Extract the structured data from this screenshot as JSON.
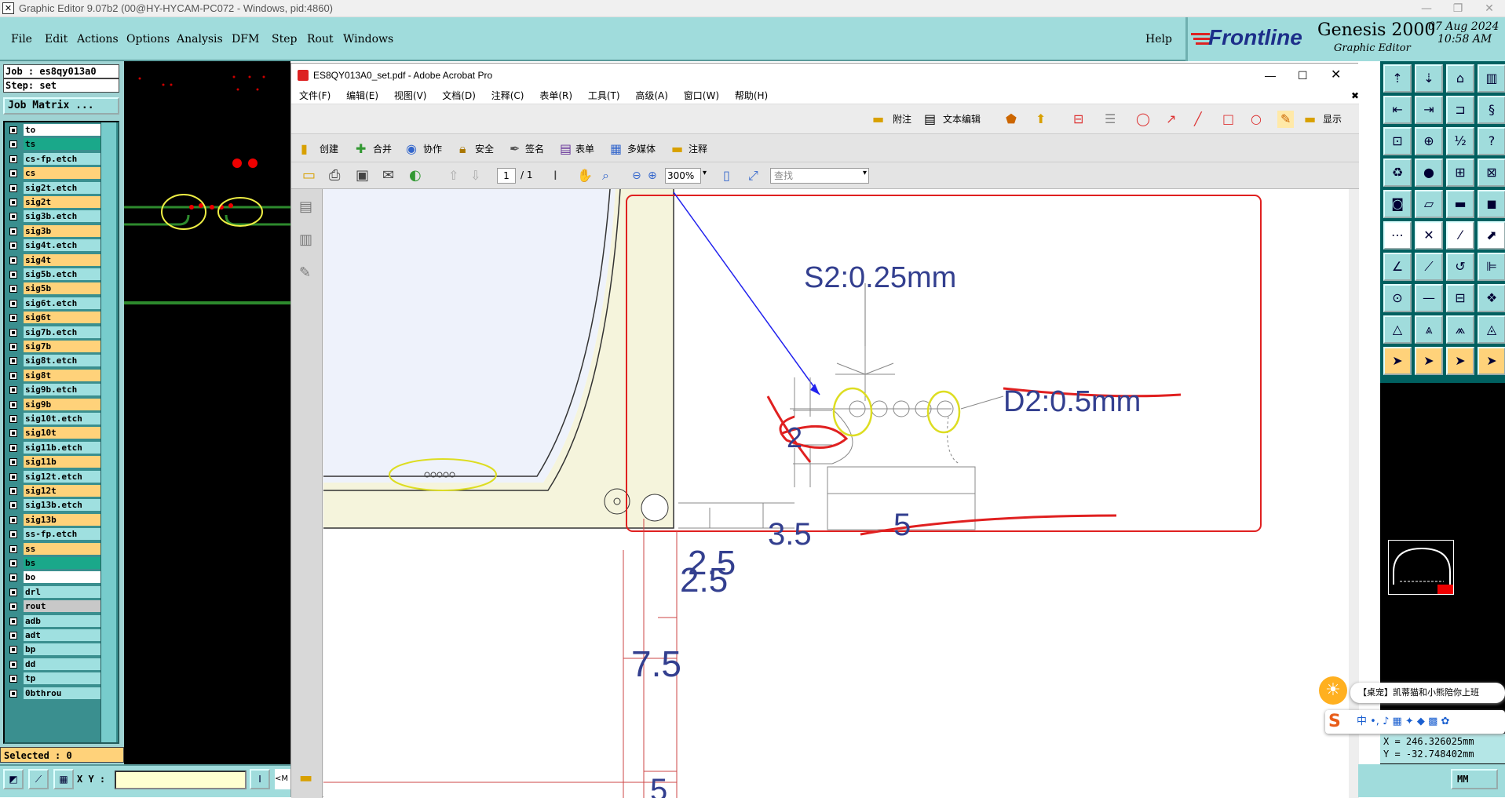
{
  "app": {
    "title": "Graphic Editor 9.07b2 (00@HY-HYCAM-PC072 - Windows, pid:4860)",
    "menu": [
      "File",
      "Edit",
      "Actions",
      "Options",
      "Analysis",
      "DFM",
      "Step",
      "Rout",
      "Windows"
    ],
    "help": "Help",
    "brand": "Frontline",
    "product": "Genesis 2000",
    "subtitle": "Graphic Editor",
    "date": "07 Aug 2024",
    "time": "10:58 AM"
  },
  "job": {
    "job_label": "Job : es8qy013a0",
    "step_label": "Step: set",
    "matrix_button": "Job Matrix ...",
    "selected": "Selected : 0",
    "xy_label": "X Y :",
    "layers": [
      {
        "name": "to",
        "color": "#ffffff"
      },
      {
        "name": "ts",
        "color": "#1aa88a"
      },
      {
        "name": "cs-fp.etch",
        "color": "#9fe0e0"
      },
      {
        "name": "cs",
        "color": "#ffd27a"
      },
      {
        "name": "sig2t.etch",
        "color": "#9fe0e0"
      },
      {
        "name": "sig2t",
        "color": "#ffd27a"
      },
      {
        "name": "sig3b.etch",
        "color": "#9fe0e0"
      },
      {
        "name": "sig3b",
        "color": "#ffd27a"
      },
      {
        "name": "sig4t.etch",
        "color": "#9fe0e0"
      },
      {
        "name": "sig4t",
        "color": "#ffd27a"
      },
      {
        "name": "sig5b.etch",
        "color": "#9fe0e0"
      },
      {
        "name": "sig5b",
        "color": "#ffd27a"
      },
      {
        "name": "sig6t.etch",
        "color": "#9fe0e0"
      },
      {
        "name": "sig6t",
        "color": "#ffd27a"
      },
      {
        "name": "sig7b.etch",
        "color": "#9fe0e0"
      },
      {
        "name": "sig7b",
        "color": "#ffd27a"
      },
      {
        "name": "sig8t.etch",
        "color": "#9fe0e0"
      },
      {
        "name": "sig8t",
        "color": "#ffd27a"
      },
      {
        "name": "sig9b.etch",
        "color": "#9fe0e0"
      },
      {
        "name": "sig9b",
        "color": "#ffd27a"
      },
      {
        "name": "sig10t.etch",
        "color": "#9fe0e0"
      },
      {
        "name": "sig10t",
        "color": "#ffd27a"
      },
      {
        "name": "sig11b.etch",
        "color": "#9fe0e0"
      },
      {
        "name": "sig11b",
        "color": "#ffd27a"
      },
      {
        "name": "sig12t.etch",
        "color": "#9fe0e0"
      },
      {
        "name": "sig12t",
        "color": "#ffd27a"
      },
      {
        "name": "sig13b.etch",
        "color": "#9fe0e0"
      },
      {
        "name": "sig13b",
        "color": "#ffd27a"
      },
      {
        "name": "ss-fp.etch",
        "color": "#9fe0e0"
      },
      {
        "name": "ss",
        "color": "#ffd27a"
      },
      {
        "name": "bs",
        "color": "#1aa88a"
      },
      {
        "name": "bo",
        "color": "#ffffff"
      },
      {
        "name": "drl",
        "color": "#9fe0e0"
      },
      {
        "name": "rout",
        "color": "#c8c8c8"
      },
      {
        "name": "adb",
        "color": "#9fe0e0"
      },
      {
        "name": "adt",
        "color": "#9fe0e0"
      },
      {
        "name": "bp",
        "color": "#9fe0e0"
      },
      {
        "name": "dd",
        "color": "#9fe0e0"
      },
      {
        "name": "tp",
        "color": "#9fe0e0"
      },
      {
        "name": "0bthrou",
        "color": "#9fe0e0"
      }
    ]
  },
  "acrobat": {
    "title": "ES8QY013A0_set.pdf - Adobe Acrobat Pro",
    "menu": [
      "文件(F)",
      "编辑(E)",
      "视图(V)",
      "文档(D)",
      "注释(C)",
      "表单(R)",
      "工具(T)",
      "高级(A)",
      "窗口(W)",
      "帮助(H)"
    ],
    "tb1": {
      "comment": "附注",
      "text_edit": "文本编辑",
      "show": "显示"
    },
    "tb2": [
      "创建",
      "合并",
      "协作",
      "安全",
      "签名",
      "表单",
      "多媒体",
      "注释"
    ],
    "page_current": "1",
    "page_total": "/ 1",
    "zoom": "300%",
    "search_placeholder": "查找",
    "labels": {
      "s2": "S2:0.25mm",
      "d2": "D2:0.5mm",
      "two": "2",
      "five_top": "5",
      "three_five": "3.5",
      "two_five_a": "2.5",
      "two_five_b": "2.5",
      "seven_five": "7.5",
      "five_bottom": "5"
    }
  },
  "status": {
    "x": "X = 246.326025mm",
    "y": "Y = -32.748402mm",
    "unit": "MM"
  },
  "ime": {
    "note": "【桌宠】凯蒂猫和小熊陪你上班",
    "bar": "中 •, ♪ ▦ ✦ ◆ ▩ ✿"
  }
}
